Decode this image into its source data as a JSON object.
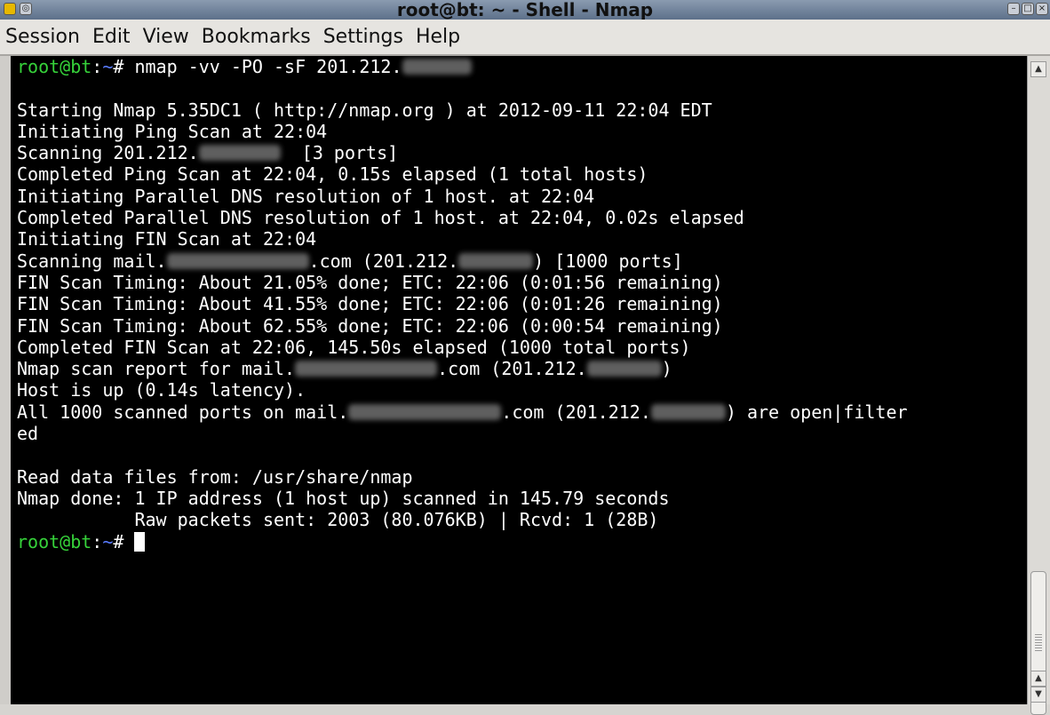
{
  "window": {
    "title": "root@bt: ~ - Shell - Nmap",
    "app_icon": "konsole-icon",
    "title_buttons": [
      "minimize",
      "maximize",
      "close"
    ]
  },
  "menubar": {
    "items": [
      {
        "label": "Session"
      },
      {
        "label": "Edit"
      },
      {
        "label": "View"
      },
      {
        "label": "Bookmarks"
      },
      {
        "label": "Settings"
      },
      {
        "label": "Help"
      }
    ]
  },
  "terminal": {
    "prompt_user": "root@bt",
    "prompt_dir": "~",
    "prompt_suffix": "# ",
    "command": "nmap -vv -PO -sF 201.212.",
    "lines": [
      "",
      "Starting Nmap 5.35DC1 ( http://nmap.org ) at 2012-09-11 22:04 EDT",
      "Initiating Ping Scan at 22:04",
      "Scanning 201.212.",
      "Completed Ping Scan at 22:04, 0.15s elapsed (1 total hosts)",
      "Initiating Parallel DNS resolution of 1 host. at 22:04",
      "Completed Parallel DNS resolution of 1 host. at 22:04, 0.02s elapsed",
      "Initiating FIN Scan at 22:04",
      "Scanning mail.",
      "FIN Scan Timing: About 21.05% done; ETC: 22:06 (0:01:56 remaining)",
      "FIN Scan Timing: About 41.55% done; ETC: 22:06 (0:01:26 remaining)",
      "FIN Scan Timing: About 62.55% done; ETC: 22:06 (0:00:54 remaining)",
      "Completed FIN Scan at 22:06, 145.50s elapsed (1000 total ports)",
      "Nmap scan report for mail.",
      "Host is up (0.14s latency).",
      "All 1000 scanned ports on mail.",
      "ed",
      "",
      "Read data files from: /usr/share/nmap",
      "Nmap done: 1 IP address (1 host up) scanned in 145.79 seconds",
      "           Raw packets sent: 2003 (80.076KB) | Rcvd: 1 (28B)"
    ],
    "frag": {
      "scan_ports_tail": "  [3 ports]",
      "com_ip": ".com (201.212.",
      "ports_1000": ") [1000 ports]",
      "close_paren": ")",
      "are_open": ") are open|filter"
    }
  },
  "colors": {
    "prompt_user": "#36d23a",
    "prompt_dir": "#5a7cff",
    "background": "#000000",
    "foreground": "#ffffff"
  }
}
